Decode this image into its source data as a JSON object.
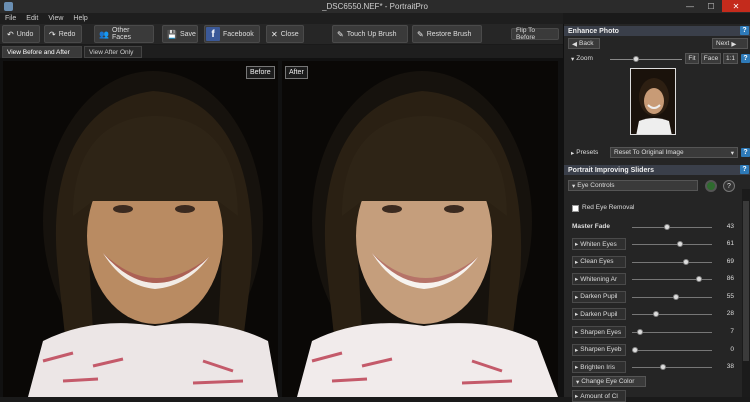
{
  "window": {
    "title": "_DSC6550.NEF* - PortraitPro",
    "minimize": "—",
    "maximize": "☐",
    "close": "✕"
  },
  "menu": [
    "File",
    "Edit",
    "View",
    "Help"
  ],
  "toolbar": {
    "undo": "Undo",
    "redo": "Redo",
    "other_faces": "Other Faces",
    "save": "Save",
    "facebook": "Facebook",
    "close": "Close",
    "touch_up": "Touch Up Brush",
    "restore": "Restore Brush",
    "flip": "Flip To Before"
  },
  "tabs": [
    "View Before and After",
    "View After Only"
  ],
  "viewer": {
    "before_label": "Before",
    "after_label": "After"
  },
  "enhance": {
    "title": "Enhance Photo",
    "back": "Back",
    "next": "Next",
    "zoom": "Zoom",
    "zoom_level": 0.35,
    "fit": "Fit",
    "face": "Face",
    "one_to_one": "1:1"
  },
  "presets": {
    "label": "Presets",
    "value": "Reset To Original Image"
  },
  "sliders_panel": {
    "title": "Portrait Improving Sliders",
    "eye_controls": "Eye Controls",
    "red_eye": "Red Eye Removal",
    "master_fade_label": "Master Fade",
    "master_fade_value": "43",
    "rows": [
      {
        "label": "Whiten Eyes",
        "value": "61"
      },
      {
        "label": "Clean Eyes",
        "value": "69"
      },
      {
        "label": "Whitening Ar",
        "value": "86"
      },
      {
        "label": "Darken Pupil",
        "value": "55"
      },
      {
        "label": "Darken Pupil",
        "value": "28"
      },
      {
        "label": "Sharpen Eyes",
        "value": "7"
      },
      {
        "label": "Sharpen Eyeb",
        "value": "0"
      },
      {
        "label": "Brighten Iris",
        "value": "38"
      }
    ],
    "change_eye_color": "Change Eye Color",
    "amount_row": "Amount of Cl"
  }
}
